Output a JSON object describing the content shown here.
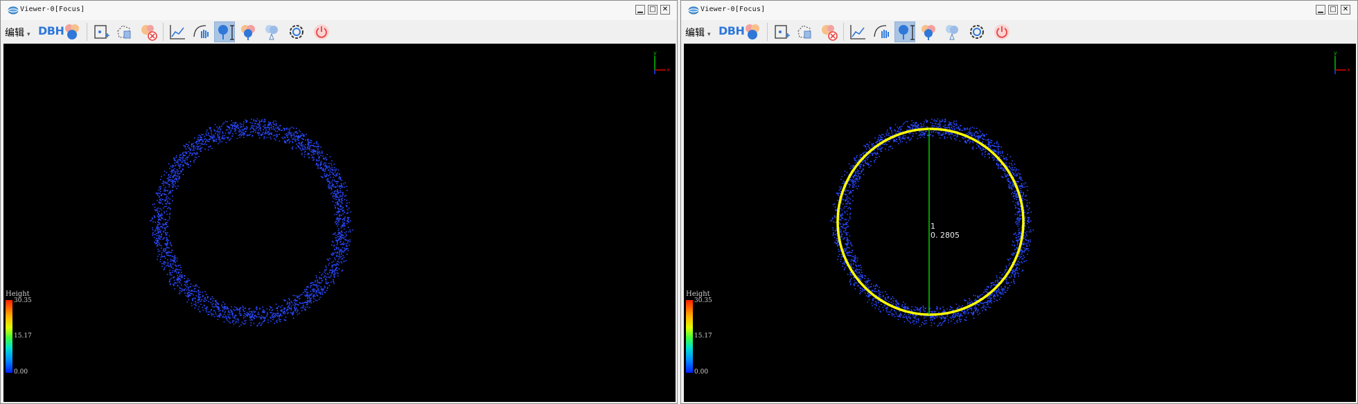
{
  "windows": [
    {
      "title": "Viewer-0[Focus]",
      "edit_menu": "编辑",
      "dbh_label": "DBH",
      "controls": {
        "minimize": "▁",
        "maximize": "□",
        "close": "✕"
      },
      "colorbar": {
        "title": "Height",
        "max": "30.35",
        "mid": "15.17",
        "min": "0.00"
      },
      "axis_gizmo": {
        "y": "y",
        "x": "x"
      },
      "fit": null
    },
    {
      "title": "Viewer-0[Focus]",
      "edit_menu": "编辑",
      "dbh_label": "DBH",
      "controls": {
        "minimize": "▁",
        "maximize": "□",
        "close": "✕"
      },
      "colorbar": {
        "title": "Height",
        "max": "30.35",
        "mid": "15.17",
        "min": "0.00"
      },
      "axis_gizmo": {
        "y": "y",
        "x": "x"
      },
      "fit": {
        "id": "1",
        "diameter": "0. 2805"
      }
    }
  ],
  "toolbar_icons": [
    "trees-icon",
    "add-point-icon",
    "delete-selection-icon",
    "remove-trees-icon",
    "profile-chart-icon",
    "hand-select-icon",
    "tree-height-icon",
    "tree-color-icon",
    "tree-crown-icon",
    "settings-gear-icon",
    "power-icon"
  ],
  "colors": {
    "points": "#2a49ff",
    "fit_circle": "#ffff00",
    "diameter_line": "#00d000",
    "active_tool": "#a9c4e4",
    "dbh_text": "#2f78d9"
  }
}
